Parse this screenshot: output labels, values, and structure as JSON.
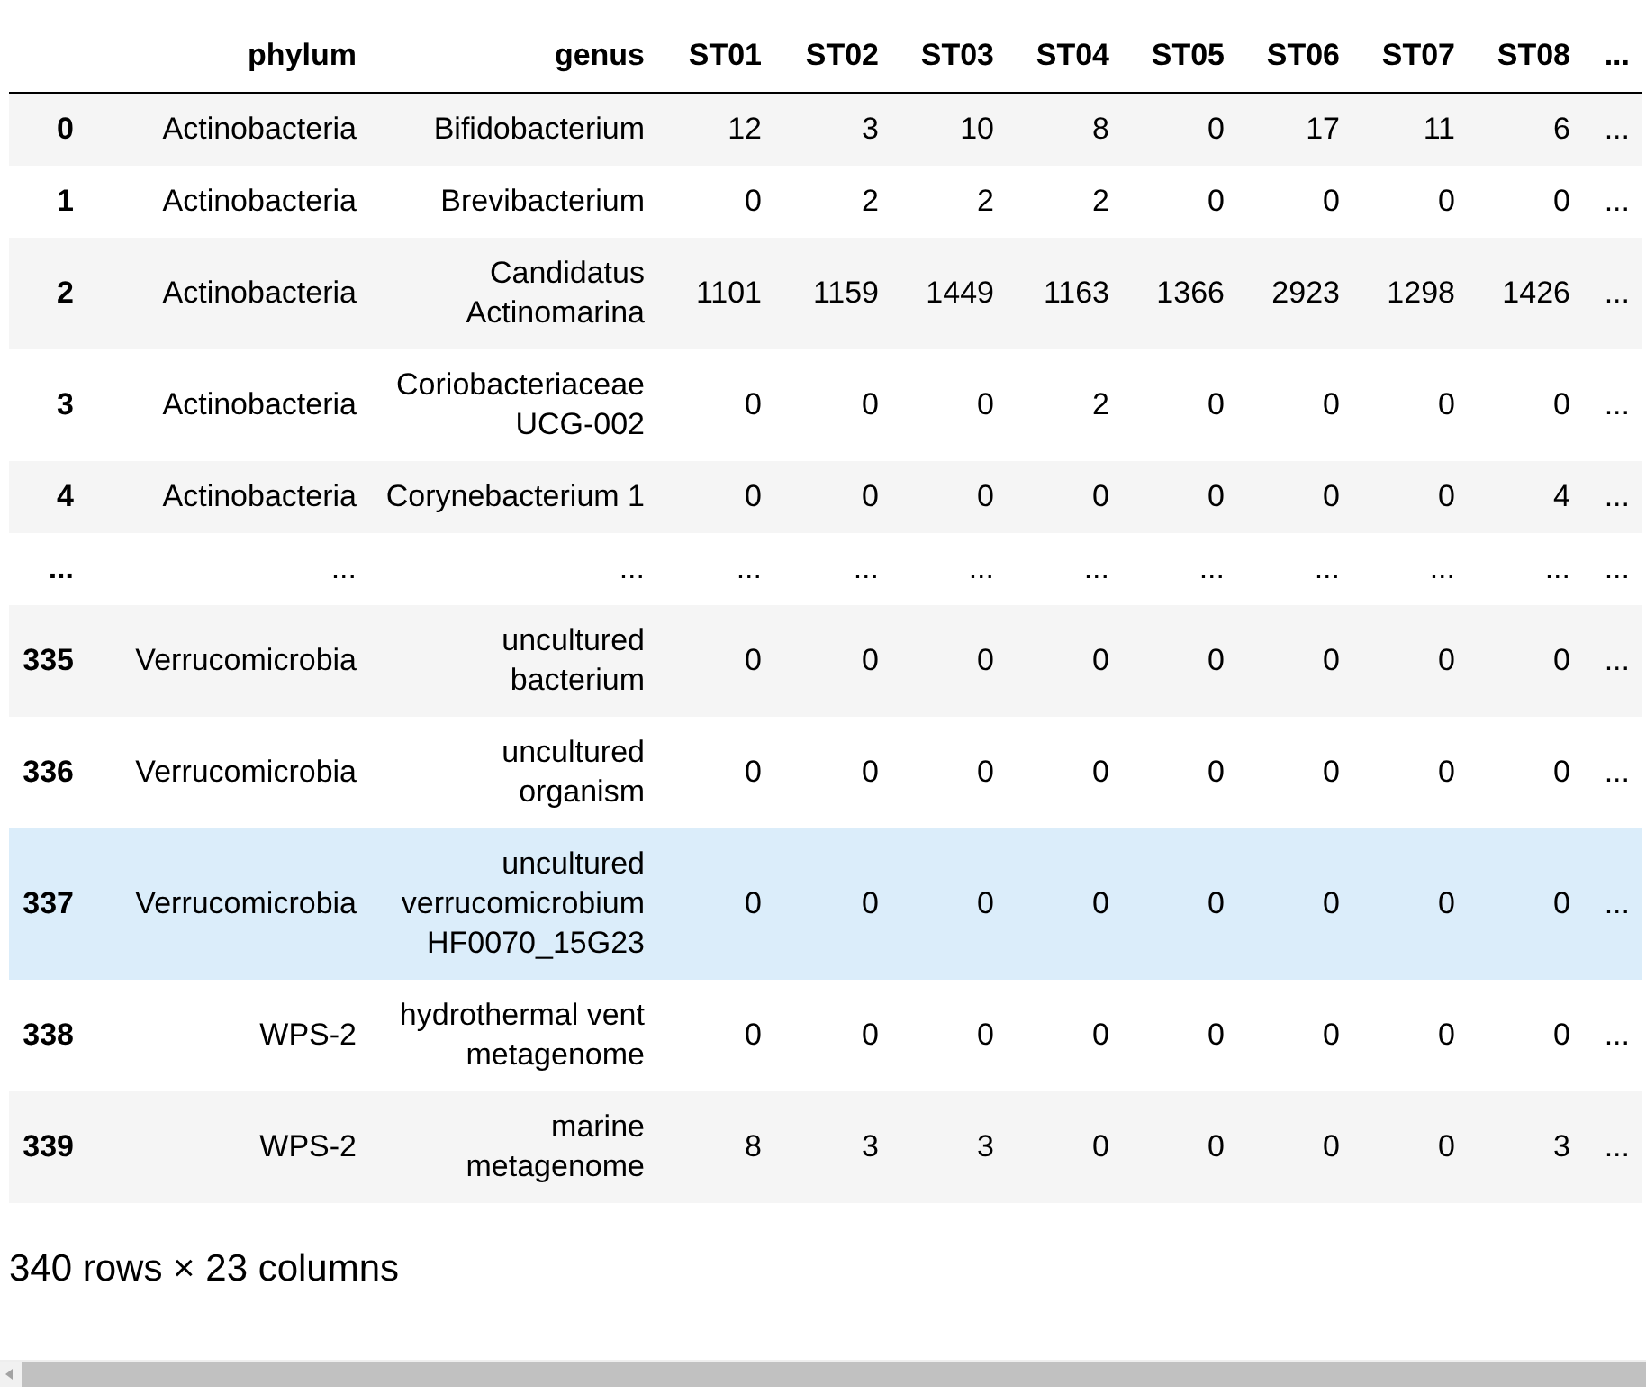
{
  "table": {
    "columns": [
      "phylum",
      "genus",
      "ST01",
      "ST02",
      "ST03",
      "ST04",
      "ST05",
      "ST06",
      "ST07",
      "ST08",
      "..."
    ],
    "rows": [
      {
        "index": "0",
        "cells": [
          "Actinobacteria",
          "Bifidobacterium",
          "12",
          "3",
          "10",
          "8",
          "0",
          "17",
          "11",
          "6",
          "..."
        ],
        "highlighted": false
      },
      {
        "index": "1",
        "cells": [
          "Actinobacteria",
          "Brevibacterium",
          "0",
          "2",
          "2",
          "2",
          "0",
          "0",
          "0",
          "0",
          "..."
        ],
        "highlighted": false
      },
      {
        "index": "2",
        "cells": [
          "Actinobacteria",
          "Candidatus Actinomarina",
          "1101",
          "1159",
          "1449",
          "1163",
          "1366",
          "2923",
          "1298",
          "1426",
          "..."
        ],
        "highlighted": false
      },
      {
        "index": "3",
        "cells": [
          "Actinobacteria",
          "Coriobacteriaceae UCG-002",
          "0",
          "0",
          "0",
          "2",
          "0",
          "0",
          "0",
          "0",
          "..."
        ],
        "highlighted": false
      },
      {
        "index": "4",
        "cells": [
          "Actinobacteria",
          "Corynebacterium 1",
          "0",
          "0",
          "0",
          "0",
          "0",
          "0",
          "0",
          "4",
          "..."
        ],
        "highlighted": false
      },
      {
        "index": "...",
        "cells": [
          "...",
          "...",
          "...",
          "...",
          "...",
          "...",
          "...",
          "...",
          "...",
          "...",
          "..."
        ],
        "highlighted": false
      },
      {
        "index": "335",
        "cells": [
          "Verrucomicrobia",
          "uncultured bacterium",
          "0",
          "0",
          "0",
          "0",
          "0",
          "0",
          "0",
          "0",
          "..."
        ],
        "highlighted": false
      },
      {
        "index": "336",
        "cells": [
          "Verrucomicrobia",
          "uncultured organism",
          "0",
          "0",
          "0",
          "0",
          "0",
          "0",
          "0",
          "0",
          "..."
        ],
        "highlighted": false
      },
      {
        "index": "337",
        "cells": [
          "Verrucomicrobia",
          "uncultured verrucomicrobium HF0070_15G23",
          "0",
          "0",
          "0",
          "0",
          "0",
          "0",
          "0",
          "0",
          "..."
        ],
        "highlighted": true
      },
      {
        "index": "338",
        "cells": [
          "WPS-2",
          "hydrothermal vent metagenome",
          "0",
          "0",
          "0",
          "0",
          "0",
          "0",
          "0",
          "0",
          "..."
        ],
        "highlighted": false
      },
      {
        "index": "339",
        "cells": [
          "WPS-2",
          "marine metagenome",
          "8",
          "3",
          "3",
          "0",
          "0",
          "0",
          "0",
          "3",
          "..."
        ],
        "highlighted": false
      }
    ]
  },
  "footer": "340 rows × 23 columns"
}
